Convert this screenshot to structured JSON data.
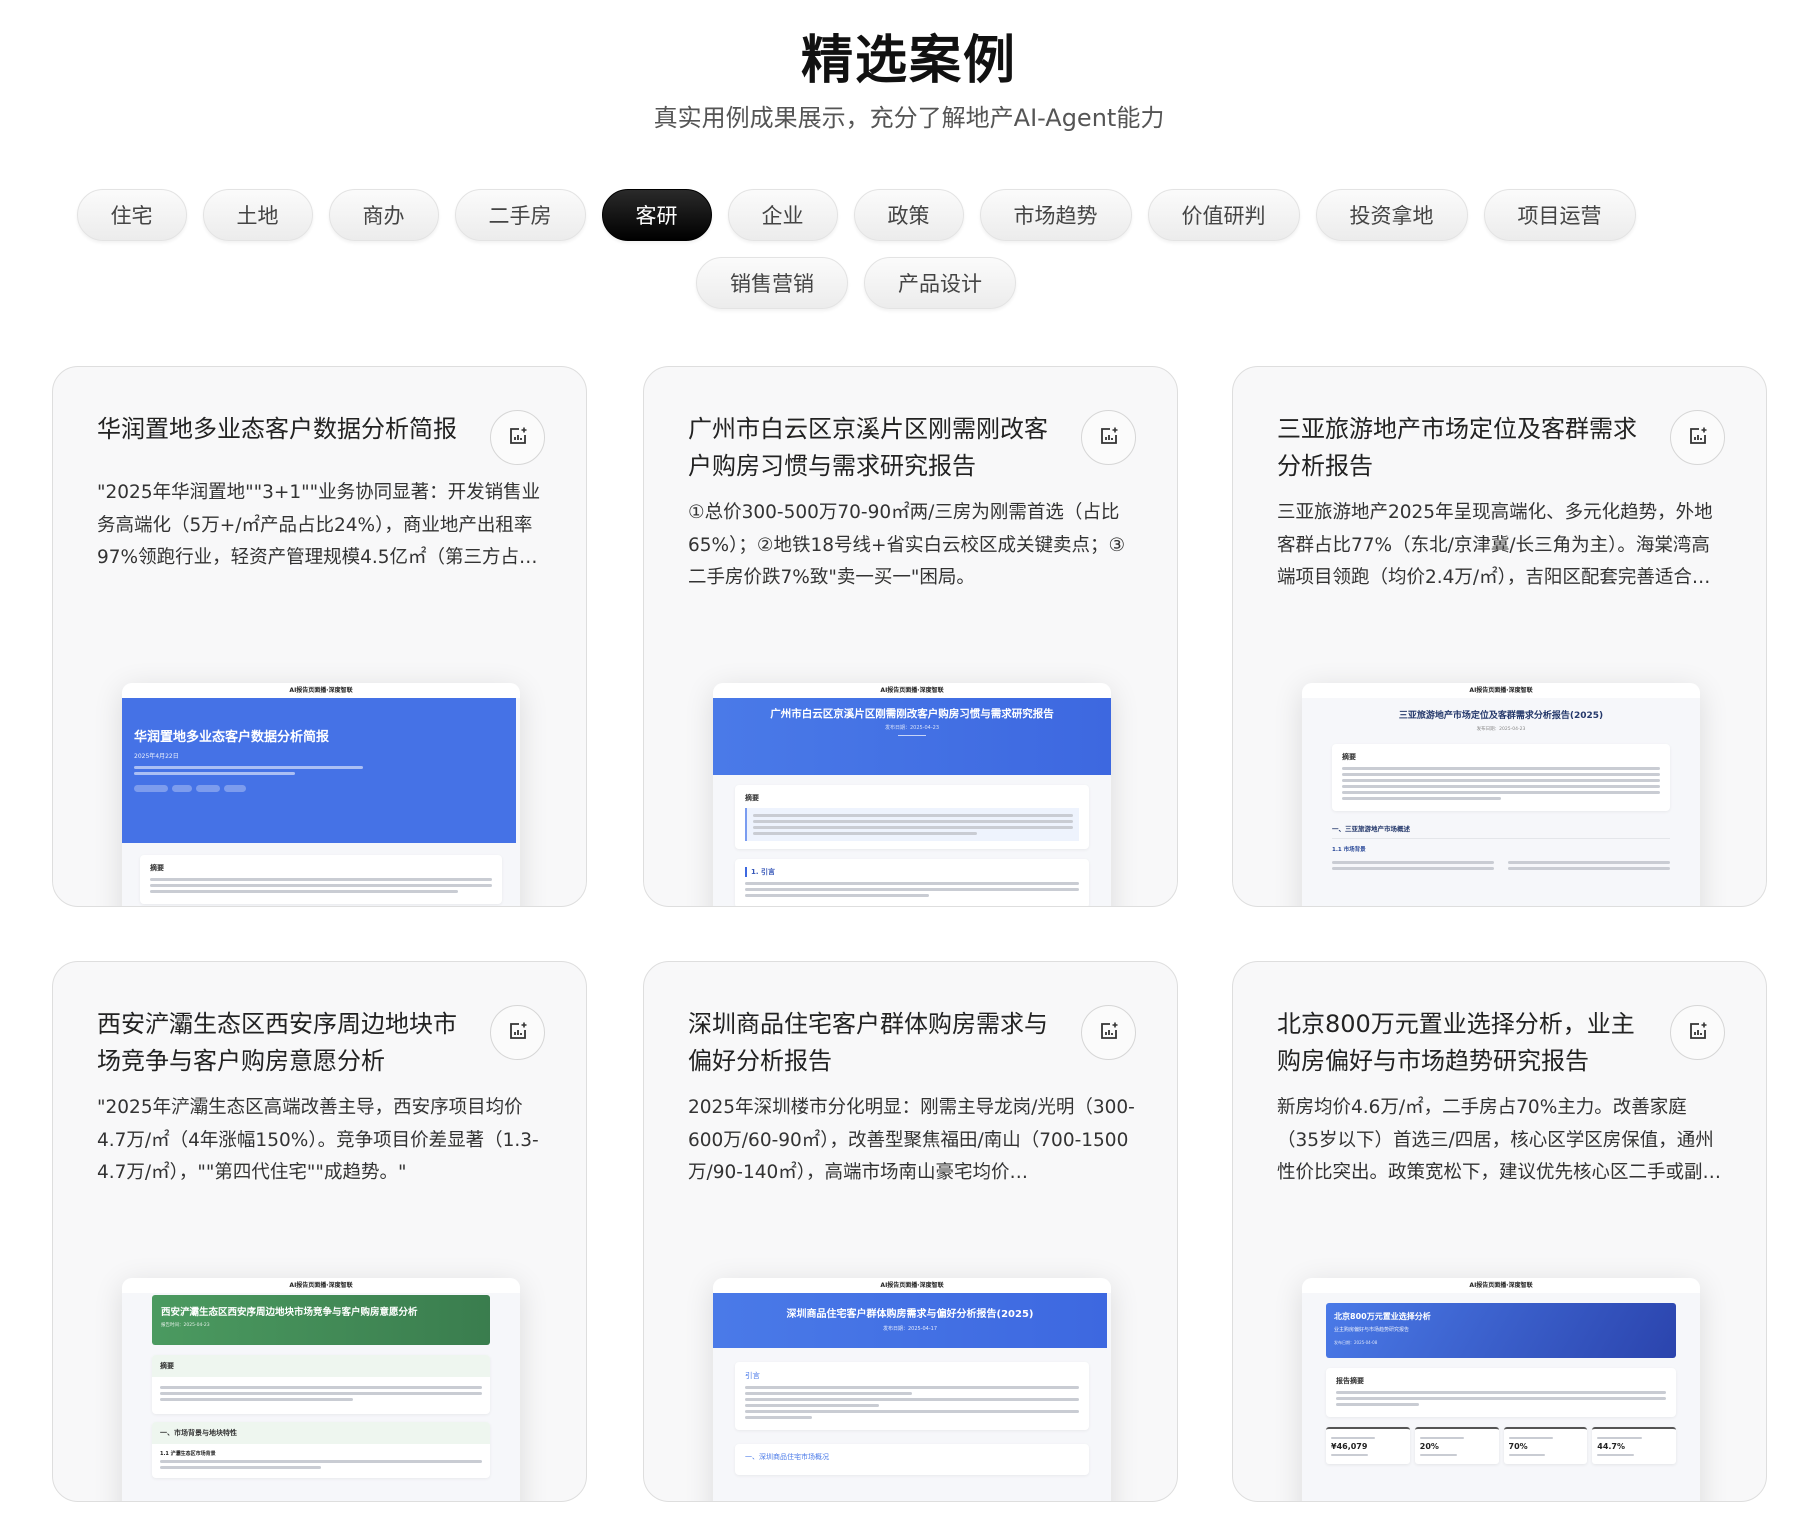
{
  "header": {
    "title": "精选案例",
    "subtitle": "真实用例成果展示，充分了解地产AI-Agent能力"
  },
  "filters": {
    "active": "客研",
    "row1": [
      "住宅",
      "土地",
      "商办",
      "二手房",
      "客研",
      "企业",
      "政策",
      "市场趋势",
      "价值研判",
      "投资拿地",
      "项目运营"
    ],
    "row2": [
      "销售营销",
      "产品设计"
    ]
  },
  "colors": {
    "blue_banner": "#4572e6",
    "green_banner": "#3f8a55",
    "active_pill": "#000000"
  },
  "cards": [
    {
      "title": "华润置地多业态客户数据分析简报",
      "description": "\"2025年华润置地\"\"3+1\"\"业务协同显著：开发销售业务高端化（5万+/㎡产品占比24%），商业地产出租率97%领跑行业，轻资产管理规模4.5亿㎡（第三方占比…",
      "icon": "report-chart-sparkle-icon",
      "preview": {
        "type": "banner-left",
        "top_bar": "AI报告页面播·深度智联",
        "title": "华润置地多业态客户数据分析简报",
        "date": "2025年4月22日",
        "section": "摘要"
      }
    },
    {
      "title": "广州市白云区京溪片区刚需刚改客户购房习惯与需求研究报告",
      "description": "①总价300-500万70-90㎡两/三房为刚需首选（占比65%）；②地铁18号线+省实白云校区成关键卖点；③二手房价跌7%致\"卖一买一\"困局。",
      "icon": "report-chart-sparkle-icon",
      "preview": {
        "type": "banner-center",
        "top_bar": "AI报告页面播·深度智联",
        "title": "广州市白云区京溪片区刚需刚改客户购房习惯与需求研究报告",
        "date": "发布日期：2025-04-23",
        "section": "摘要",
        "section2": "1. 引言"
      }
    },
    {
      "title": "三亚旅游地产市场定位及客群需求分析报告",
      "description": "三亚旅游地产2025年呈现高端化、多元化趋势，外地客群占比77%（东北/京津冀/长三角为主）。海棠湾高端项目领跑（均价2.4万/㎡），吉阳区配套完善适合…",
      "icon": "report-chart-sparkle-icon",
      "preview": {
        "type": "plain",
        "top_bar": "AI报告页面播·深度智联",
        "title": "三亚旅游地产市场定位及客群需求分析报告(2025)",
        "date": "发布日期：2025-04-23",
        "section": "摘要",
        "section2": "一、三亚旅游地产市场概述",
        "section3": "1.1 市场背景"
      }
    },
    {
      "title": "西安浐灞生态区西安序周边地块市场竞争与客户购房意愿分析",
      "description": "\"2025年浐灞生态区高端改善主导，西安序项目均价4.7万/㎡（4年涨幅150%）。竞争项目价差显著（1.3-4.7万/㎡），\"\"第四代住宅\"\"成趋势。\"",
      "icon": "report-chart-sparkle-icon",
      "preview": {
        "type": "green",
        "top_bar": "AI报告页面播·深度智联",
        "title": "西安浐灞生态区西安序周边地块市场竞争与客户购房意愿分析",
        "date": "报告时间：2025-04-23",
        "section": "摘要",
        "section2": "一、市场背景与地块特性",
        "section3": "1.1 浐灞生态区市场背景"
      }
    },
    {
      "title": "深圳商品住宅客户群体购房需求与偏好分析报告",
      "description": "2025年深圳楼市分化明显：刚需主导龙岗/光明（300-600万/60-90㎡），改善型聚焦福田/南山（700-1500万/90-140㎡），高端市场南山豪宅均价…",
      "icon": "report-chart-sparkle-icon",
      "preview": {
        "type": "banner-wide",
        "top_bar": "AI报告页面播·深度智联",
        "title": "深圳商品住宅客户群体购房需求与偏好分析报告(2025)",
        "date": "发布日期：2025-04-17",
        "section": "引言",
        "section2": "一、深圳商品住宅市场概况"
      }
    },
    {
      "title": "北京800万元置业选择分析，业主购房偏好与市场趋势研究报告",
      "description": "新房均价4.6万/㎡，二手房占70%主力。改善家庭（35岁以下）首选三/四居，核心区学区房保值，通州性价比突出。政策宽松下，建议优先核心区二手或副…",
      "icon": "report-chart-sparkle-icon",
      "preview": {
        "type": "stats",
        "top_bar": "AI报告页面播·深度智联",
        "title": "北京800万元置业选择分析",
        "subtitle": "业主购房偏好与市场趋势研究报告",
        "date": "发布日期：2025-04-08",
        "section": "报告摘要",
        "stats": [
          "¥46,079",
          "20%",
          "70%",
          "44.7%"
        ]
      }
    }
  ]
}
